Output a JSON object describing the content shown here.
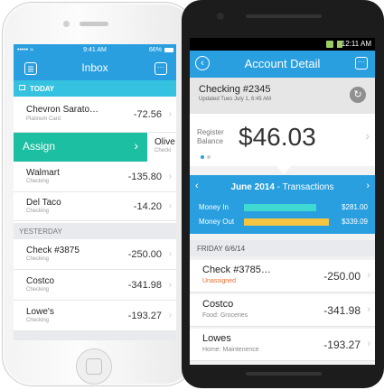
{
  "colors": {
    "accent": "#2a9fe0",
    "today": "#35c2e0",
    "assign": "#1cbfa1",
    "money_in": "#3fd9d2",
    "money_out": "#f5c542",
    "unassigned": "#e86c2f"
  },
  "iphone": {
    "status": {
      "carrier": "••••• ≈",
      "time": "9:41 AM",
      "battery": "66%"
    },
    "nav": {
      "title": "Inbox",
      "menu_icon": "menu-icon",
      "more_icon": "more-icon"
    },
    "today_header": "TODAY",
    "today_items": [
      {
        "name": "Chevron Sarato…",
        "sub": "Platinum Card",
        "amount": "-72.56"
      },
      {
        "name": "Walmart",
        "sub": "Checking",
        "amount": "-135.80"
      },
      {
        "name": "Del Taco",
        "sub": "Checking",
        "amount": "-14.20"
      }
    ],
    "swipe": {
      "action": "Assign",
      "peek_name": "Olive",
      "peek_sub": "Checki"
    },
    "yesterday_header": "YESTERDAY",
    "yesterday_items": [
      {
        "name": "Check #3875",
        "sub": "Checking",
        "amount": "-250.00"
      },
      {
        "name": "Costco",
        "sub": "Checking",
        "amount": "-341.98"
      },
      {
        "name": "Lowe's",
        "sub": "Checking",
        "amount": "-193.27"
      }
    ]
  },
  "android": {
    "status": {
      "time": "12:11 AM"
    },
    "nav": {
      "title": "Account Detail"
    },
    "account": {
      "name": "Checking #2345",
      "updated": "Updated Tues July 1, 6:45 AM"
    },
    "balance": {
      "label_line1": "Register",
      "label_line2": "Balance",
      "value": "$46.03"
    },
    "month": {
      "title": "June 2014",
      "subtitle": "- Transactions"
    },
    "money_in": {
      "label": "Money In",
      "value": "$281.00",
      "fill": 0.85
    },
    "money_out": {
      "label": "Money Out",
      "value": "$339.09",
      "fill": 1.0
    },
    "day_header": "FRIDAY   6/6/14",
    "transactions": [
      {
        "name": "Check #3785…",
        "sub": "Unassigned",
        "amount": "-250.00"
      },
      {
        "name": "Costco",
        "sub": "Food: Groceries",
        "amount": "-341.98"
      },
      {
        "name": "Lowes",
        "sub": "Home: Maintenence",
        "amount": "-193.27"
      }
    ]
  }
}
